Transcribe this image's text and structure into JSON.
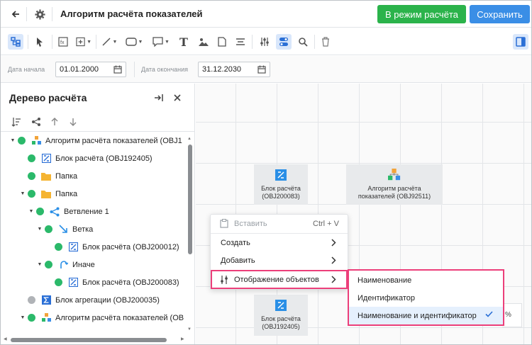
{
  "header": {
    "title": "Алгоритм расчёта показателей",
    "calc_mode_button": "В режим расчёта",
    "save_button": "Сохранить"
  },
  "toolbar": {
    "icons": [
      "tree-view-icon",
      "pointer-icon",
      "function-icon",
      "add-block-icon",
      "line-icon",
      "rectangle-icon",
      "comment-icon",
      "text-icon",
      "image-icon",
      "document-icon",
      "align-icon",
      "settings-icon",
      "toggle-icon",
      "search-icon",
      "trash-icon",
      "panel-right-icon"
    ],
    "text_tool": "T"
  },
  "dates": {
    "start_label": "Дата начала",
    "start_value": "01.01.2000",
    "end_label": "Дата окончания",
    "end_value": "31.12.2030"
  },
  "panel": {
    "title": "Дерево расчёта",
    "tree": [
      {
        "label": "Алгоритм расчёта показателей (OBJ1",
        "icon": "algorithm-icon"
      },
      {
        "label": "Блок расчёта (OBJ192405)",
        "icon": "calc-block-icon"
      },
      {
        "label": "Папка",
        "icon": "folder-icon"
      },
      {
        "label": "Папка",
        "icon": "folder-icon"
      },
      {
        "label": "Ветвление 1",
        "icon": "branching-icon"
      },
      {
        "label": "Ветка",
        "icon": "branch-icon"
      },
      {
        "label": "Блок расчёта (OBJ200012)",
        "icon": "calc-block-icon"
      },
      {
        "label": "Иначе",
        "icon": "else-icon"
      },
      {
        "label": "Блок расчёта (OBJ200083)",
        "icon": "calc-block-icon"
      },
      {
        "label": "Блок агрегации (OBJ200035)",
        "icon": "aggregation-icon"
      },
      {
        "label": "Алгоритм расчёта показателей (OB",
        "icon": "algorithm-icon"
      }
    ]
  },
  "canvas": {
    "nodes": [
      {
        "line1": "Блок расчёта",
        "line2": "(OBJ200083)"
      },
      {
        "line1": "Алгоритм расчёта",
        "line2": "показателей (OBJ92511)"
      },
      {
        "line1": "Блок расчёта",
        "line2": "(OBJ192405)"
      }
    ],
    "stub_text": "%"
  },
  "context_menu": {
    "paste": "Вставить",
    "paste_shortcut": "Ctrl + V",
    "create": "Создать",
    "add": "Добавить",
    "display": "Отображение объектов"
  },
  "submenu": {
    "items": [
      "Наименование",
      "Идентификатор",
      "Наименование и идентификатор"
    ],
    "selected_index": 2
  },
  "colors": {
    "green_button": "#2bb34b",
    "blue_button": "#3a8ee6",
    "highlight": "#ec3f7a",
    "tree_dot": "#2bb96a"
  }
}
